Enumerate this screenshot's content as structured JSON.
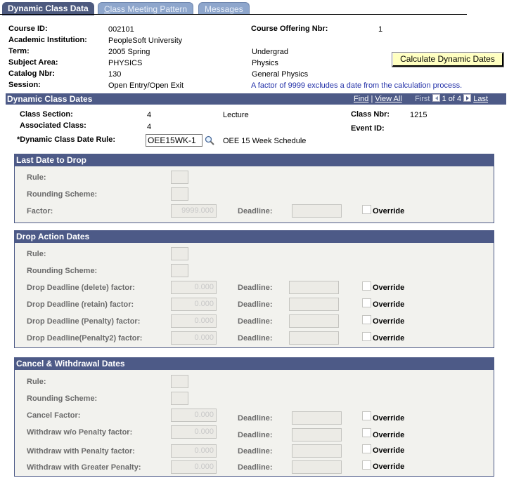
{
  "tabs": [
    {
      "label": "Dynamic Class Data",
      "active": true
    },
    {
      "label": "Class Meeting Pattern",
      "accesskey": "C",
      "active": false
    },
    {
      "label": "Messages",
      "active": false
    }
  ],
  "header": {
    "course_id": {
      "label": "Course ID:",
      "value": "002101"
    },
    "academic_institution": {
      "label": "Academic Institution:",
      "value": "PeopleSoft University"
    },
    "term": {
      "label": "Term:",
      "value": "2005 Spring",
      "desc": "Undergrad"
    },
    "subject_area": {
      "label": "Subject Area:",
      "value": "PHYSICS",
      "desc": "Physics"
    },
    "catalog_nbr": {
      "label": "Catalog Nbr:",
      "value": "130",
      "desc": "General Physics"
    },
    "session": {
      "label": "Session:",
      "value": "Open Entry/Open Exit"
    },
    "course_offering_nbr": {
      "label": "Course Offering Nbr:",
      "value": "1"
    },
    "note": "A factor of 9999 excludes a date from the calculation process.",
    "calculate_button": "Calculate Dynamic Dates"
  },
  "dynamic_class_dates": {
    "title": "Dynamic Class Dates",
    "nav": {
      "find": "Find",
      "separator": "|",
      "view_all": "View All",
      "first": "First",
      "position": "1 of 4",
      "last": "Last"
    },
    "class_section": {
      "label": "Class Section:",
      "value": "4",
      "component": "Lecture"
    },
    "associated_class": {
      "label": "Associated Class:",
      "value": "4"
    },
    "class_nbr": {
      "label": "Class Nbr:",
      "value": "1215"
    },
    "event_id": {
      "label": "Event ID:",
      "value": ""
    },
    "date_rule": {
      "label": "*Dynamic Class Date Rule:",
      "value": "OEE15WK-1",
      "desc": "OEE 15 Week Schedule"
    }
  },
  "last_date_to_drop": {
    "title": "Last Date to Drop",
    "rule_label": "Rule:",
    "rounding_label": "Rounding Scheme:",
    "factor_label": "Factor:",
    "factor_value": "9999.000",
    "deadline_label": "Deadline:",
    "override_label": "Override"
  },
  "drop_action_dates": {
    "title": "Drop Action Dates",
    "rule_label": "Rule:",
    "rounding_label": "Rounding Scheme:",
    "rows": [
      {
        "label": "Drop Deadline (delete) factor:",
        "value": "0.000",
        "deadline_label": "Deadline:",
        "override_label": "Override"
      },
      {
        "label": "Drop Deadline (retain) factor:",
        "value": "0.000",
        "deadline_label": "Deadline:",
        "override_label": "Override"
      },
      {
        "label": "Drop Deadline (Penalty) factor:",
        "value": "0.000",
        "deadline_label": "Deadline:",
        "override_label": "Override"
      },
      {
        "label": "Drop Deadline(Penalty2) factor:",
        "value": "0.000",
        "deadline_label": "Deadline:",
        "override_label": "Override"
      }
    ]
  },
  "cancel_withdrawal_dates": {
    "title": "Cancel & Withdrawal Dates",
    "rule_label": "Rule:",
    "rounding_label": "Rounding Scheme:",
    "rows": [
      {
        "label": "Cancel Factor:",
        "value": "0.000",
        "deadline_label": "Deadline:",
        "override_label": "Override"
      },
      {
        "label": "Withdraw w/o Penalty factor:",
        "value": "0.000",
        "deadline_label": "Deadline:",
        "override_label": "Override"
      },
      {
        "label": "Withdraw with Penalty factor:",
        "value": "0.000",
        "deadline_label": "Deadline:",
        "override_label": "Override"
      },
      {
        "label": "Withdraw with Greater Penalty:",
        "value": "0.000",
        "deadline_label": "Deadline:",
        "override_label": "Override"
      }
    ]
  }
}
